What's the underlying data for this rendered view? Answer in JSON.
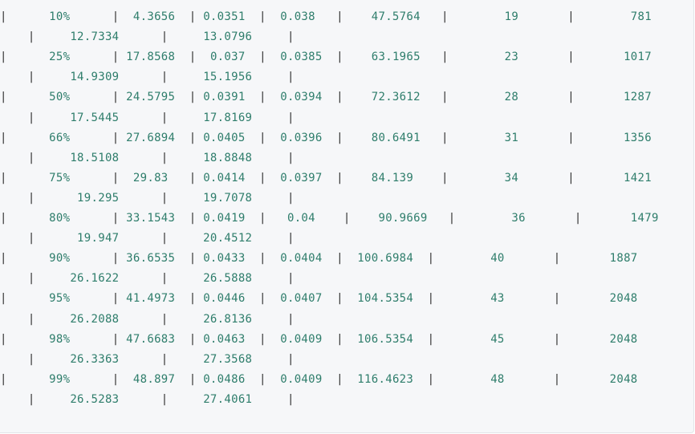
{
  "code_block": {
    "border_top": "+----+---------------+---------------+",
    "rows": [
      {
        "line1": {
          "pct": "10%",
          "c1": "4.3656",
          "c2": "0.0351",
          "c3": "0.038",
          "c4": "47.5764",
          "c5": "19",
          "c6": "781"
        },
        "line2": {
          "c7": "12.7334",
          "c8": "13.0796"
        }
      },
      {
        "line1": {
          "pct": "25%",
          "c1": "17.8568",
          "c2": "0.037",
          "c3": "0.0385",
          "c4": "63.1965",
          "c5": "23",
          "c6": "1017"
        },
        "line2": {
          "c7": "14.9309",
          "c8": "15.1956"
        }
      },
      {
        "line1": {
          "pct": "50%",
          "c1": "24.5795",
          "c2": "0.0391",
          "c3": "0.0394",
          "c4": "72.3612",
          "c5": "28",
          "c6": "1287"
        },
        "line2": {
          "c7": "17.5445",
          "c8": "17.8169"
        }
      },
      {
        "line1": {
          "pct": "66%",
          "c1": "27.6894",
          "c2": "0.0405",
          "c3": "0.0396",
          "c4": "80.6491",
          "c5": "31",
          "c6": "1356"
        },
        "line2": {
          "c7": "18.5108",
          "c8": "18.8848"
        }
      },
      {
        "line1": {
          "pct": "75%",
          "c1": "29.83",
          "c2": "0.0414",
          "c3": "0.0397",
          "c4": "84.139",
          "c5": "34",
          "c6": "1421"
        },
        "line2": {
          "c7": "19.295",
          "c8": "19.7078"
        }
      },
      {
        "line1": {
          "pct": "80%",
          "c1": "33.1543",
          "c2": "0.0419",
          "c3": "0.04",
          "c4": "90.9669",
          "c5": "36",
          "c6": "1479"
        },
        "line2": {
          "c7": "19.947",
          "c8": "20.4512"
        }
      },
      {
        "line1": {
          "pct": "90%",
          "c1": "36.6535",
          "c2": "0.0433",
          "c3": "0.0404",
          "c4": "100.6984",
          "c5": "40",
          "c6": "1887"
        },
        "line2": {
          "c7": "26.1622",
          "c8": "26.5888"
        }
      },
      {
        "line1": {
          "pct": "95%",
          "c1": "41.4973",
          "c2": "0.0446",
          "c3": "0.0407",
          "c4": "104.5354",
          "c5": "43",
          "c6": "2048"
        },
        "line2": {
          "c7": "26.2088",
          "c8": "26.8136"
        }
      },
      {
        "line1": {
          "pct": "98%",
          "c1": "47.6683",
          "c2": "0.0463",
          "c3": "0.0409",
          "c4": "106.5354",
          "c5": "45",
          "c6": "2048"
        },
        "line2": {
          "c7": "26.3363",
          "c8": "27.3568"
        }
      },
      {
        "line1": {
          "pct": "99%",
          "c1": "48.897",
          "c2": "0.0486",
          "c3": "0.0409",
          "c4": "116.4623",
          "c5": "48",
          "c6": "2048"
        },
        "line2": {
          "c7": "26.5283",
          "c8": "27.4061"
        }
      }
    ]
  },
  "colors": {
    "background": "#f6f7f9",
    "number": "#2e7d6b",
    "pipe": "#333333",
    "border": "#c0392b"
  }
}
